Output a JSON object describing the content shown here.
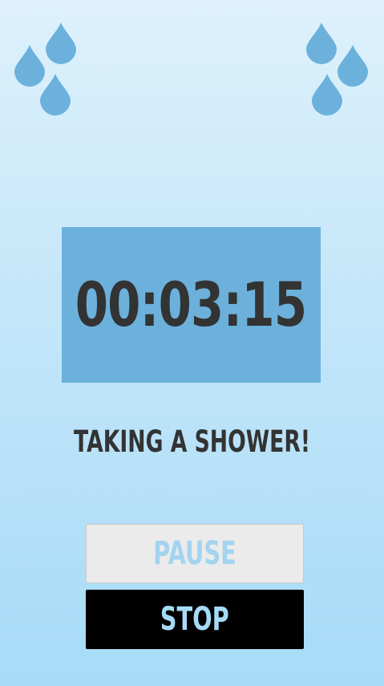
{
  "timer": {
    "display": "00:03:15"
  },
  "status": {
    "text": "TAKING A SHOWER!"
  },
  "controls": {
    "pause_label": "PAUSE",
    "stop_label": "STOP"
  },
  "decorations": {
    "icon": "water-drop-icon",
    "color": "#6cb1dc"
  },
  "theme": {
    "background_top": "#def1fc",
    "background_bottom": "#a6dbf7",
    "timer_box": "#6cb1dc",
    "text": "#333333",
    "pause_bg": "#ebebeb",
    "pause_text": "#a3d4ef",
    "stop_bg": "#000000",
    "stop_text": "#a6dbf7"
  }
}
